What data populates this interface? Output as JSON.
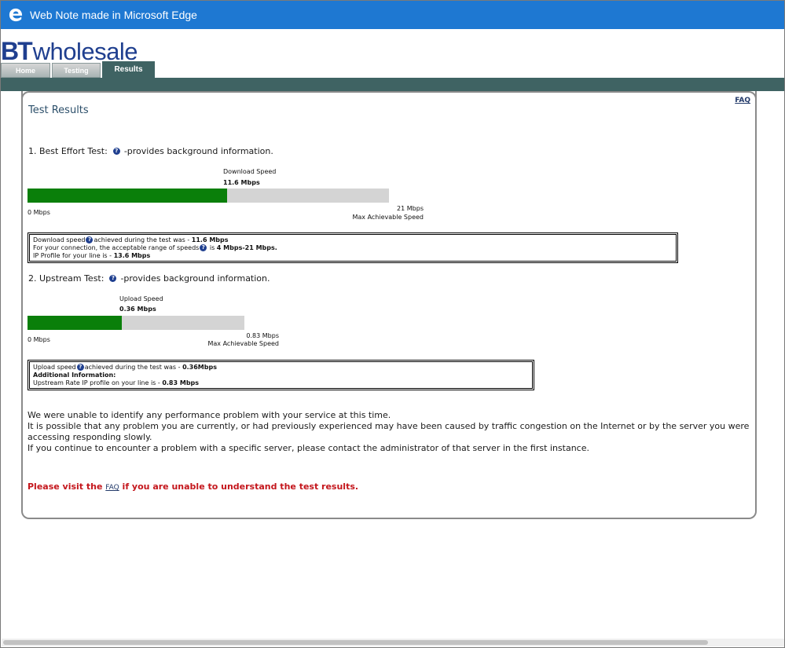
{
  "window": {
    "title": "Web Note made in Microsoft Edge"
  },
  "logo": {
    "bt": "BT",
    "wholesale": "wholesale"
  },
  "tabs": [
    {
      "label": "Home"
    },
    {
      "label": "Testing"
    },
    {
      "label": "Results"
    }
  ],
  "faq": "FAQ",
  "page_title": "Test Results",
  "best_effort": {
    "title": "1. Best Effort Test:",
    "help_glyph": "?",
    "suffix": "-provides background information.",
    "bar_label": "Download  Speed",
    "bar_value": "11.6 Mbps",
    "min_label": "0 Mbps",
    "max_value": "21 Mbps",
    "max_label": "Max Achievable Speed",
    "fill_fraction": 0.552,
    "info": {
      "line1_a": "Download speed",
      "line1_b": "achieved during the test was - ",
      "line1_val": "11.6 Mbps",
      "line2_a": "For your connection, the acceptable range of speeds",
      "line2_b": " is ",
      "line2_val": "4 Mbps-21 Mbps.",
      "line3_a": "IP Profile for your line is - ",
      "line3_val": "13.6 Mbps"
    }
  },
  "upstream": {
    "title": "2. Upstream Test:",
    "help_glyph": "?",
    "suffix": "-provides background information.",
    "bar_label": "Upload Speed",
    "bar_value": "0.36 Mbps",
    "min_label": "0 Mbps",
    "max_value": "0.83 Mbps",
    "max_label": "Max Achievable Speed",
    "fill_fraction": 0.434,
    "info": {
      "line1_a": "Upload speed",
      "line1_b": "achieved during the test was - ",
      "line1_val": "0.36Mbps",
      "line2": "Additional Information:",
      "line3_a": "Upstream Rate IP profile on your line is - ",
      "line3_val": "0.83 Mbps"
    }
  },
  "message": {
    "p1": "We were unable to identify any performance problem with your service at this time.",
    "p2": "It is possible that any problem you are currently, or had previously experienced may have been caused by traffic congestion on the Internet or by the server you were accessing responding slowly.",
    "p3": "If you continue to encounter a problem with a specific server, please contact the administrator of that server in the first instance."
  },
  "notice": {
    "before": "Please visit the ",
    "link": "FAQ",
    "after": " if you are unable to understand the test results."
  },
  "colors": {
    "titlebar": "#1e78d2",
    "navbar": "#3f6363",
    "bar_fill": "#0a7f0a",
    "bar_track": "#d4d4d4",
    "notice": "#c4161c"
  }
}
